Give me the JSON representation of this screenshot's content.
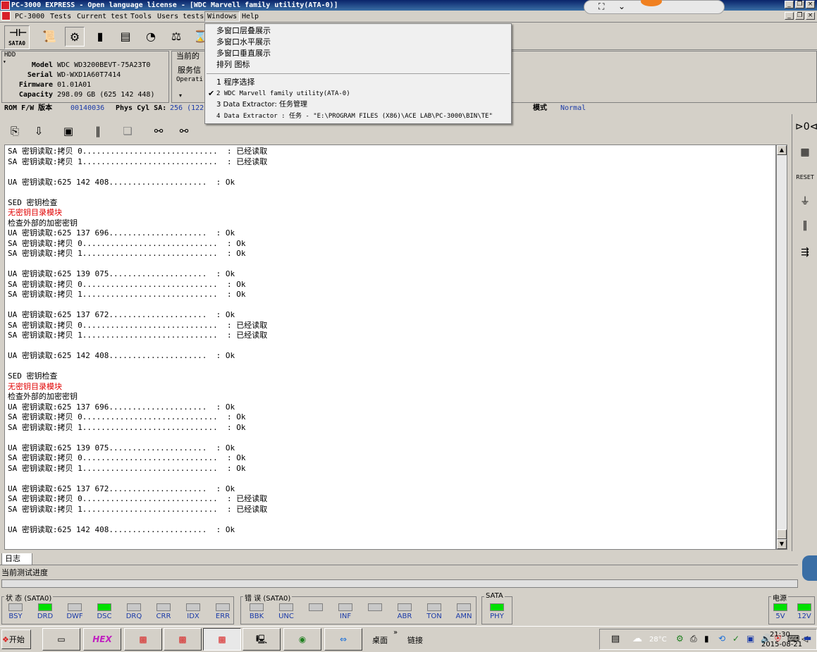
{
  "window": {
    "title": "PC-3000 EXPRESS - Open language license - [WDC Marvell family utility(ATA-0)]"
  },
  "menubar": {
    "items": [
      "PC-3000",
      "Tests",
      "Current test",
      "Tools",
      "Users tests",
      "Windows",
      "Help"
    ]
  },
  "windows_menu": {
    "items": [
      "多窗口层叠展示",
      "多窗口水平展示",
      "多窗口垂直展示",
      "排列 图标"
    ],
    "windows": [
      "1 程序选择",
      "2 WDC Marvell family utility(ATA-0)",
      "3 Data Extractor: 任务管理",
      "4 Data Extractor : 任务 - \"E:\\PROGRAM FILES (X86)\\ACE LAB\\PC-3000\\BIN\\TE\""
    ],
    "checked_index": 1
  },
  "toolbar": {
    "sata_label": "SATA0"
  },
  "hdd": {
    "group_label": "HDD",
    "model_label": "Model",
    "model": "WDC WD3200BEVT-75A23T0",
    "serial_label": "Serial",
    "serial": "WD-WXD1A60T7414",
    "firmware_label": "Firmware",
    "firmware": "01.01A01",
    "capacity_label": "Capacity",
    "capacity": "298.09 GB (625 142 448)"
  },
  "info_panel": {
    "current_label": "当前的",
    "service_label": "服务信",
    "operation_label": "Operati"
  },
  "status_line": {
    "rom_label": "ROM F/W 版本",
    "rom_value": "00140036",
    "phys_label": "Phys Cyl SA:",
    "phys_value": "256 (122)",
    "mode_label": "模式",
    "mode_value": "Normal"
  },
  "log": {
    "lines": [
      {
        "t": "SA 密钥读取:拷贝 0.............................  : 已经读取",
        "red": false
      },
      {
        "t": "SA 密钥读取:拷贝 1.............................  : 已经读取",
        "red": false
      },
      {
        "t": "",
        "red": false
      },
      {
        "t": "UA 密钥读取:625 142 408.....................  : Ok",
        "red": false
      },
      {
        "t": "",
        "red": false
      },
      {
        "t": "SED 密钥检查",
        "red": false
      },
      {
        "t": "无密钥目录模块",
        "red": true
      },
      {
        "t": "检查外部的加密密钥",
        "red": false
      },
      {
        "t": "UA 密钥读取:625 137 696.....................  : Ok",
        "red": false
      },
      {
        "t": "SA 密钥读取:拷贝 0.............................  : Ok",
        "red": false
      },
      {
        "t": "SA 密钥读取:拷贝 1.............................  : Ok",
        "red": false
      },
      {
        "t": "",
        "red": false
      },
      {
        "t": "UA 密钥读取:625 139 075.....................  : Ok",
        "red": false
      },
      {
        "t": "SA 密钥读取:拷贝 0.............................  : Ok",
        "red": false
      },
      {
        "t": "SA 密钥读取:拷贝 1.............................  : Ok",
        "red": false
      },
      {
        "t": "",
        "red": false
      },
      {
        "t": "UA 密钥读取:625 137 672.....................  : Ok",
        "red": false
      },
      {
        "t": "SA 密钥读取:拷贝 0.............................  : 已经读取",
        "red": false
      },
      {
        "t": "SA 密钥读取:拷贝 1.............................  : 已经读取",
        "red": false
      },
      {
        "t": "",
        "red": false
      },
      {
        "t": "UA 密钥读取:625 142 408.....................  : Ok",
        "red": false
      },
      {
        "t": "",
        "red": false
      },
      {
        "t": "SED 密钥检查",
        "red": false
      },
      {
        "t": "无密钥目录模块",
        "red": true
      },
      {
        "t": "检查外部的加密密钥",
        "red": false
      },
      {
        "t": "UA 密钥读取:625 137 696.....................  : Ok",
        "red": false
      },
      {
        "t": "SA 密钥读取:拷贝 0.............................  : Ok",
        "red": false
      },
      {
        "t": "SA 密钥读取:拷贝 1.............................  : Ok",
        "red": false
      },
      {
        "t": "",
        "red": false
      },
      {
        "t": "UA 密钥读取:625 139 075.....................  : Ok",
        "red": false
      },
      {
        "t": "SA 密钥读取:拷贝 0.............................  : Ok",
        "red": false
      },
      {
        "t": "SA 密钥读取:拷贝 1.............................  : Ok",
        "red": false
      },
      {
        "t": "",
        "red": false
      },
      {
        "t": "UA 密钥读取:625 137 672.....................  : Ok",
        "red": false
      },
      {
        "t": "SA 密钥读取:拷贝 0.............................  : 已经读取",
        "red": false
      },
      {
        "t": "SA 密钥读取:拷贝 1.............................  : 已经读取",
        "red": false
      },
      {
        "t": "",
        "red": false
      },
      {
        "t": "UA 密钥读取:625 142 408.....................  : Ok",
        "red": false
      }
    ]
  },
  "tabs": {
    "log_tab": "日志"
  },
  "progress": {
    "label": "当前测试进度",
    "fraction": 0
  },
  "status_group": {
    "label": "状 态 (SATA0)",
    "leds": [
      {
        "name": "BSY",
        "on": false
      },
      {
        "name": "DRD",
        "on": true
      },
      {
        "name": "DWF",
        "on": false
      },
      {
        "name": "DSC",
        "on": true
      },
      {
        "name": "DRQ",
        "on": false
      },
      {
        "name": "CRR",
        "on": false
      },
      {
        "name": "IDX",
        "on": false
      },
      {
        "name": "ERR",
        "on": false
      }
    ]
  },
  "error_group": {
    "label": "错 误 (SATA0)",
    "leds": [
      {
        "name": "BBK",
        "on": false
      },
      {
        "name": "UNC",
        "on": false
      },
      {
        "name": "",
        "on": false
      },
      {
        "name": "INF",
        "on": false
      },
      {
        "name": "",
        "on": false
      },
      {
        "name": "ABR",
        "on": false
      },
      {
        "name": "TON",
        "on": false
      },
      {
        "name": "AMN",
        "on": false
      }
    ]
  },
  "sata_group": {
    "label": "SATA",
    "leds": [
      {
        "name": "PHY",
        "on": true
      }
    ]
  },
  "power_group": {
    "label": "电源",
    "leds": [
      {
        "name": "5V",
        "on": true
      },
      {
        "name": "12V",
        "on": true
      }
    ]
  },
  "taskbar": {
    "start_label": "开始",
    "desktop_label": "桌面",
    "links_label": "链接",
    "temperature": "28°C",
    "time": "21:30",
    "date": "2015-08-21",
    "hex_app": "HEX"
  },
  "colors": {
    "title_start": "#0a246a",
    "title_end": "#3a6ea5",
    "led_on": "#00e000",
    "red_text": "#e00000",
    "link_blue": "#1a3aa8"
  }
}
